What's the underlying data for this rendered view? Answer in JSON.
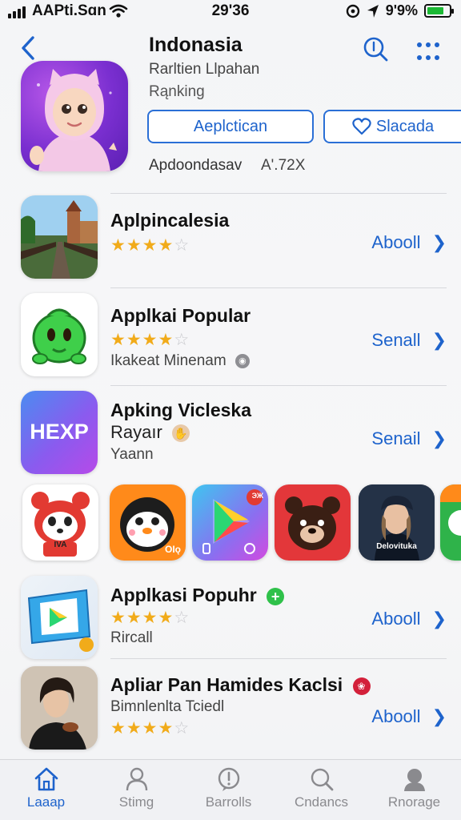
{
  "status_bar": {
    "carrier": "AAPti.Sɑn",
    "time": "29'36",
    "battery": "9'9%"
  },
  "app": {
    "title": "Indonasia",
    "subtitle": "Rarltien Llpahan",
    "ranking": "Rąnking",
    "primary_button": "Aeplctican",
    "secondary_button": "Slacada",
    "meta_label": "Apdoondasav",
    "meta_value": "A'.72X"
  },
  "list_top": [
    {
      "title": "Aplpincalesia",
      "subtitle": "",
      "rating": 3.5,
      "action": "Aboоll"
    },
    {
      "title": "Applkai Popular",
      "subtitle": "Ikakeat Minenam",
      "rating": 3.5,
      "action": "Senall"
    },
    {
      "title": "Apking Vicleska",
      "title2": "Rayaır",
      "subtitle": "Yaann",
      "icon_text": "HEXP",
      "action": "Senail"
    }
  ],
  "carousel": [
    {
      "icon": "red-panda-icon",
      "text": "IVA"
    },
    {
      "icon": "penguin-icon",
      "text": "OIǫ"
    },
    {
      "icon": "play-store-icon",
      "text": "ЭЖ"
    },
    {
      "icon": "bear-icon",
      "text": ""
    },
    {
      "icon": "portrait-icon",
      "text": "Delovituka"
    },
    {
      "icon": "partial-icon",
      "text": ""
    }
  ],
  "list_bottom": [
    {
      "title": "Applkasi Popuhr",
      "subtitle": "Rircall",
      "rating": 3.5,
      "action": "Aboоll"
    },
    {
      "title": "Apliar Pan Hamides Kaclsi",
      "subtitle": "Bimnlenlta Tciedl",
      "rating": 4,
      "action": "Aboоll"
    }
  ],
  "tabs": [
    {
      "label": "Laaap",
      "icon": "home-icon",
      "active": true
    },
    {
      "label": "Stimg",
      "icon": "person-icon",
      "active": false
    },
    {
      "label": "Barrolls",
      "icon": "alert-icon",
      "active": false
    },
    {
      "label": "Cndancs",
      "icon": "search-icon",
      "active": false
    },
    {
      "label": "Rnorage",
      "icon": "profile-icon",
      "active": false
    }
  ],
  "colors": {
    "accent": "#1e63cc",
    "star": "#f1ab1a",
    "battery": "#1bb934"
  }
}
